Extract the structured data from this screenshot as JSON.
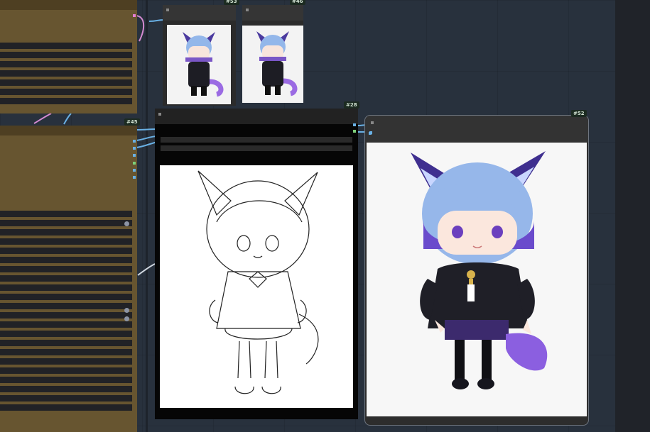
{
  "nodes": {
    "n53": {
      "id": "#53"
    },
    "n46": {
      "id": "#46"
    },
    "n28": {
      "id": "#28"
    },
    "n52": {
      "id": "#52"
    },
    "n45": {
      "id": "#45"
    }
  },
  "colors": {
    "canvas": "#28313d",
    "group_olive": "#675530",
    "node_body": "#2b2b2b",
    "wire_pink": "#d48ad1",
    "wire_blue": "#69b0e4"
  },
  "icons": [
    "image-preview",
    "lineart-preview",
    "output-preview"
  ]
}
